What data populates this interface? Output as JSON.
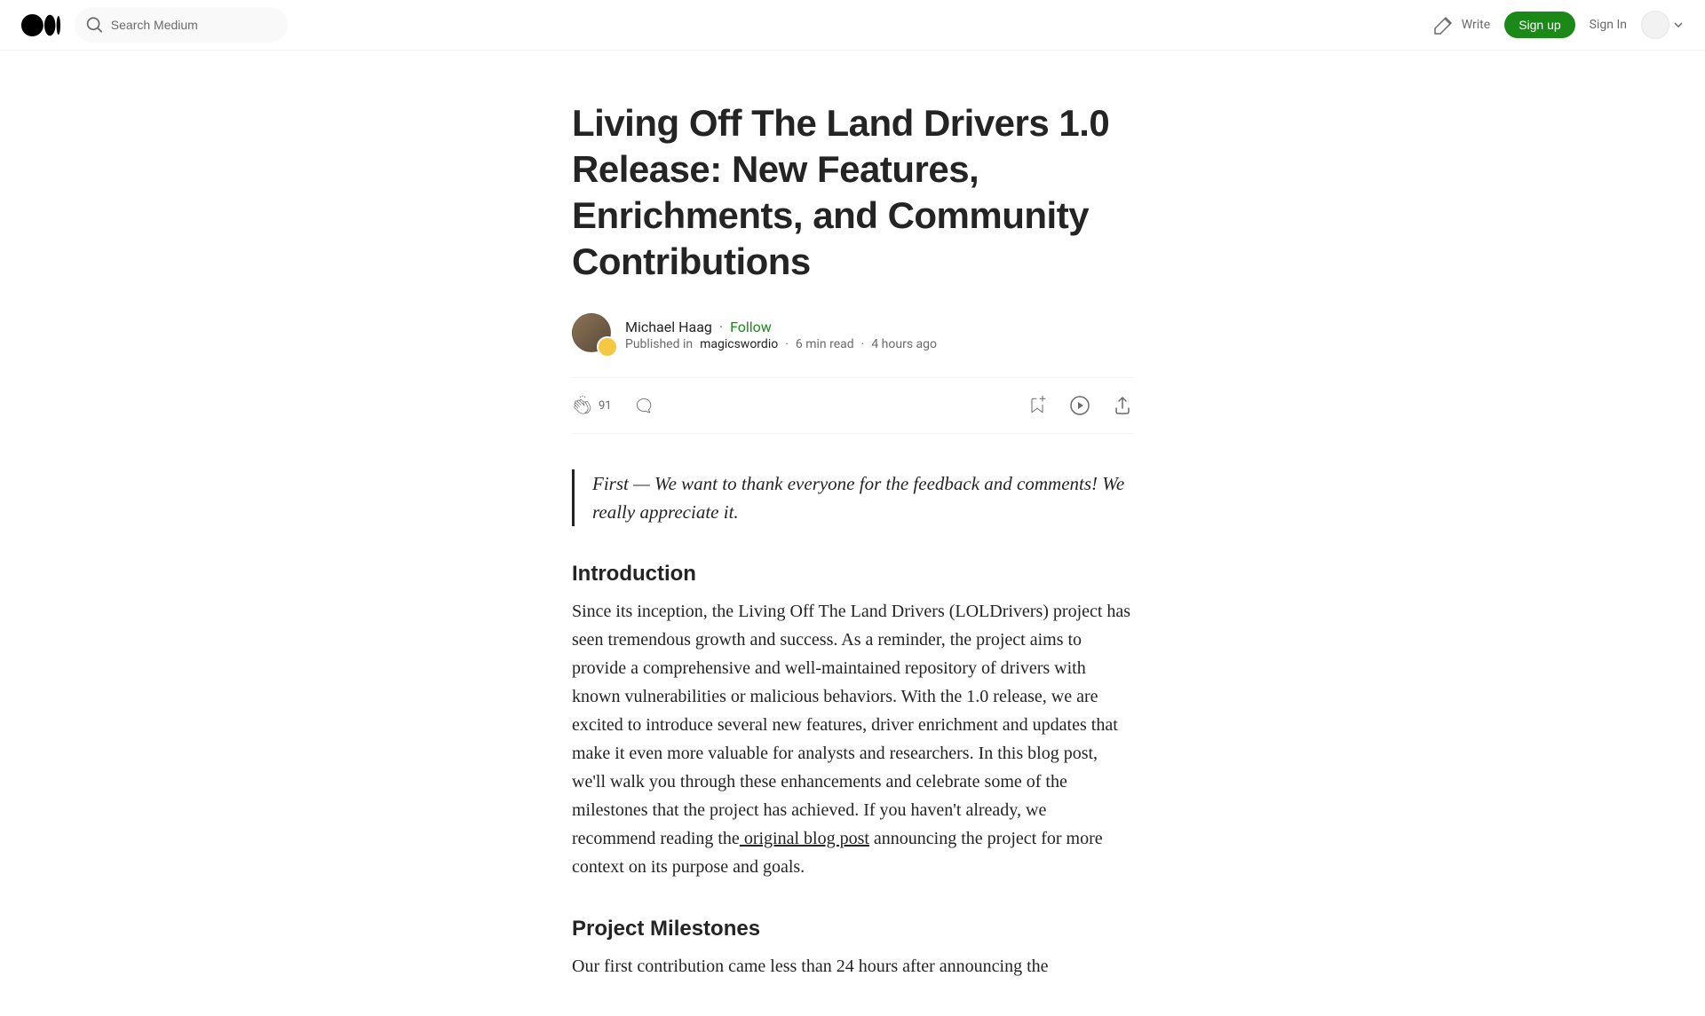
{
  "header": {
    "search_placeholder": "Search Medium",
    "write_label": "Write",
    "signup_label": "Sign up",
    "signin_label": "Sign In"
  },
  "article": {
    "title": "Living Off The Land Drivers 1.0 Release: New Features, Enrichments, and Community Contributions",
    "author": {
      "name": "Michael Haag",
      "follow_label": "Follow",
      "published_in_prefix": "Published in",
      "publication": "magicswordio",
      "read_time": "6 min read",
      "date": "4 hours ago"
    },
    "actions": {
      "clap_count": "91"
    },
    "blockquote": "First — We want to thank everyone for the feedback and comments! We really appreciate it.",
    "section1_heading": "Introduction",
    "section1_body_pre": "Since its inception, the Living Off The Land Drivers (LOLDrivers) project has seen tremendous growth and success. As a reminder, the project aims to provide a comprehensive and well-maintained repository of drivers with known vulnerabilities or malicious behaviors. With the 1.0 release, we are excited to introduce several new features, driver enrichment and updates that make it even more valuable for analysts and researchers. In this blog post, we'll walk you through these enhancements and celebrate some of the milestones that the project has achieved. If you haven't already, we recommend reading the",
    "section1_link": " original blog post",
    "section1_body_post": " announcing the project for more context on its purpose and goals.",
    "section2_heading": "Project Milestones",
    "section2_body": "Our first contribution came less than 24 hours after announcing the"
  }
}
